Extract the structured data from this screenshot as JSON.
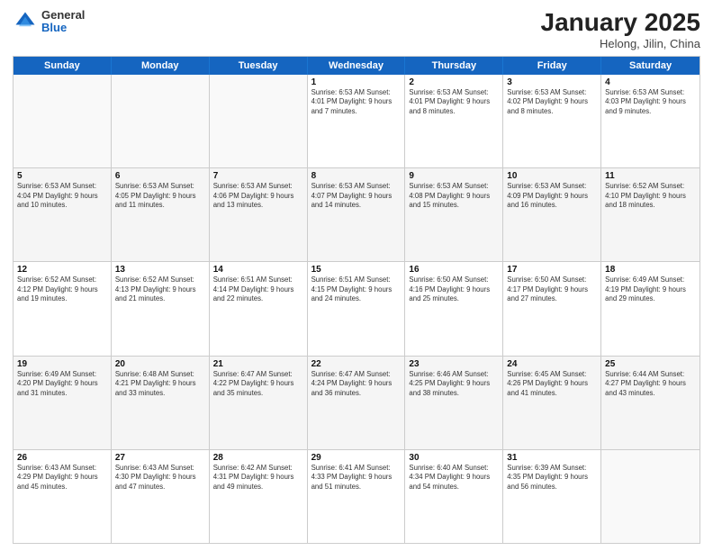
{
  "header": {
    "logo_general": "General",
    "logo_blue": "Blue",
    "month_title": "January 2025",
    "subtitle": "Helong, Jilin, China"
  },
  "days_of_week": [
    "Sunday",
    "Monday",
    "Tuesday",
    "Wednesday",
    "Thursday",
    "Friday",
    "Saturday"
  ],
  "rows": [
    [
      {
        "day": "",
        "text": "",
        "empty": true
      },
      {
        "day": "",
        "text": "",
        "empty": true
      },
      {
        "day": "",
        "text": "",
        "empty": true
      },
      {
        "day": "1",
        "text": "Sunrise: 6:53 AM\nSunset: 4:01 PM\nDaylight: 9 hours and 7 minutes."
      },
      {
        "day": "2",
        "text": "Sunrise: 6:53 AM\nSunset: 4:01 PM\nDaylight: 9 hours and 8 minutes."
      },
      {
        "day": "3",
        "text": "Sunrise: 6:53 AM\nSunset: 4:02 PM\nDaylight: 9 hours and 8 minutes."
      },
      {
        "day": "4",
        "text": "Sunrise: 6:53 AM\nSunset: 4:03 PM\nDaylight: 9 hours and 9 minutes."
      }
    ],
    [
      {
        "day": "5",
        "text": "Sunrise: 6:53 AM\nSunset: 4:04 PM\nDaylight: 9 hours and 10 minutes."
      },
      {
        "day": "6",
        "text": "Sunrise: 6:53 AM\nSunset: 4:05 PM\nDaylight: 9 hours and 11 minutes."
      },
      {
        "day": "7",
        "text": "Sunrise: 6:53 AM\nSunset: 4:06 PM\nDaylight: 9 hours and 13 minutes."
      },
      {
        "day": "8",
        "text": "Sunrise: 6:53 AM\nSunset: 4:07 PM\nDaylight: 9 hours and 14 minutes."
      },
      {
        "day": "9",
        "text": "Sunrise: 6:53 AM\nSunset: 4:08 PM\nDaylight: 9 hours and 15 minutes."
      },
      {
        "day": "10",
        "text": "Sunrise: 6:53 AM\nSunset: 4:09 PM\nDaylight: 9 hours and 16 minutes."
      },
      {
        "day": "11",
        "text": "Sunrise: 6:52 AM\nSunset: 4:10 PM\nDaylight: 9 hours and 18 minutes."
      }
    ],
    [
      {
        "day": "12",
        "text": "Sunrise: 6:52 AM\nSunset: 4:12 PM\nDaylight: 9 hours and 19 minutes."
      },
      {
        "day": "13",
        "text": "Sunrise: 6:52 AM\nSunset: 4:13 PM\nDaylight: 9 hours and 21 minutes."
      },
      {
        "day": "14",
        "text": "Sunrise: 6:51 AM\nSunset: 4:14 PM\nDaylight: 9 hours and 22 minutes."
      },
      {
        "day": "15",
        "text": "Sunrise: 6:51 AM\nSunset: 4:15 PM\nDaylight: 9 hours and 24 minutes."
      },
      {
        "day": "16",
        "text": "Sunrise: 6:50 AM\nSunset: 4:16 PM\nDaylight: 9 hours and 25 minutes."
      },
      {
        "day": "17",
        "text": "Sunrise: 6:50 AM\nSunset: 4:17 PM\nDaylight: 9 hours and 27 minutes."
      },
      {
        "day": "18",
        "text": "Sunrise: 6:49 AM\nSunset: 4:19 PM\nDaylight: 9 hours and 29 minutes."
      }
    ],
    [
      {
        "day": "19",
        "text": "Sunrise: 6:49 AM\nSunset: 4:20 PM\nDaylight: 9 hours and 31 minutes."
      },
      {
        "day": "20",
        "text": "Sunrise: 6:48 AM\nSunset: 4:21 PM\nDaylight: 9 hours and 33 minutes."
      },
      {
        "day": "21",
        "text": "Sunrise: 6:47 AM\nSunset: 4:22 PM\nDaylight: 9 hours and 35 minutes."
      },
      {
        "day": "22",
        "text": "Sunrise: 6:47 AM\nSunset: 4:24 PM\nDaylight: 9 hours and 36 minutes."
      },
      {
        "day": "23",
        "text": "Sunrise: 6:46 AM\nSunset: 4:25 PM\nDaylight: 9 hours and 38 minutes."
      },
      {
        "day": "24",
        "text": "Sunrise: 6:45 AM\nSunset: 4:26 PM\nDaylight: 9 hours and 41 minutes."
      },
      {
        "day": "25",
        "text": "Sunrise: 6:44 AM\nSunset: 4:27 PM\nDaylight: 9 hours and 43 minutes."
      }
    ],
    [
      {
        "day": "26",
        "text": "Sunrise: 6:43 AM\nSunset: 4:29 PM\nDaylight: 9 hours and 45 minutes."
      },
      {
        "day": "27",
        "text": "Sunrise: 6:43 AM\nSunset: 4:30 PM\nDaylight: 9 hours and 47 minutes."
      },
      {
        "day": "28",
        "text": "Sunrise: 6:42 AM\nSunset: 4:31 PM\nDaylight: 9 hours and 49 minutes."
      },
      {
        "day": "29",
        "text": "Sunrise: 6:41 AM\nSunset: 4:33 PM\nDaylight: 9 hours and 51 minutes."
      },
      {
        "day": "30",
        "text": "Sunrise: 6:40 AM\nSunset: 4:34 PM\nDaylight: 9 hours and 54 minutes."
      },
      {
        "day": "31",
        "text": "Sunrise: 6:39 AM\nSunset: 4:35 PM\nDaylight: 9 hours and 56 minutes."
      },
      {
        "day": "",
        "text": "",
        "empty": true
      }
    ]
  ]
}
